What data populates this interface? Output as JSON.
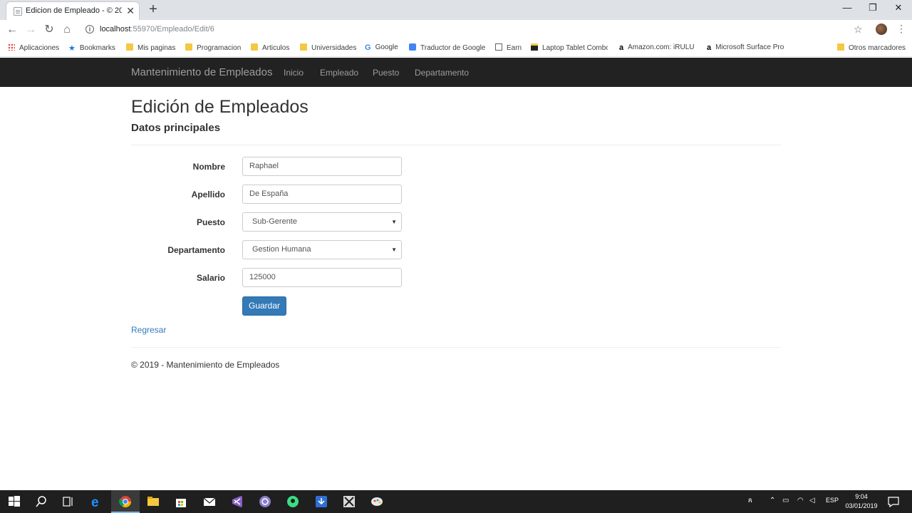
{
  "browser": {
    "tab_title": "Edicion de Empleado - © 2019 -",
    "url_host": "localhost",
    "url_path": ":55970/Empleado/Edit/6",
    "bookmarks": [
      {
        "label": "Aplicaciones",
        "icon": "apps-icon"
      },
      {
        "label": "Bookmarks",
        "icon": "star-icon"
      },
      {
        "label": "Mis paginas",
        "icon": "folder-icon"
      },
      {
        "label": "Programacion",
        "icon": "folder-icon"
      },
      {
        "label": "Articulos",
        "icon": "folder-icon"
      },
      {
        "label": "Universidades",
        "icon": "folder-icon"
      },
      {
        "label": "Google",
        "icon": "google-icon"
      },
      {
        "label": "Traductor de Google",
        "icon": "translate-icon"
      },
      {
        "label": "Earn",
        "icon": "document-icon"
      },
      {
        "label": "Laptop Tablet Combo",
        "icon": "briefcase-icon"
      },
      {
        "label": "Amazon.com: iRULU",
        "icon": "amazon-icon"
      },
      {
        "label": "Microsoft Surface Pro",
        "icon": "amazon-icon"
      },
      {
        "label": "Otros marcadores",
        "icon": "folder-icon"
      }
    ]
  },
  "navbar": {
    "brand": "Mantenimiento de Empleados",
    "links": [
      "Inicio",
      "Empleado",
      "Puesto",
      "Departamento"
    ]
  },
  "page": {
    "title": "Edición de Empleados",
    "subtitle": "Datos principales"
  },
  "form": {
    "nombre": {
      "label": "Nombre",
      "value": "Raphael"
    },
    "apellido": {
      "label": "Apellido",
      "value": "De España"
    },
    "puesto": {
      "label": "Puesto",
      "value": "Sub-Gerente"
    },
    "departamento": {
      "label": "Departamento",
      "value": "Gestion Humana"
    },
    "salario": {
      "label": "Salario",
      "value": "125000"
    },
    "submit_label": "Guardar"
  },
  "back_link": "Regresar",
  "footer": "© 2019 - Mantenimiento de Empleados",
  "taskbar": {
    "language": "ESP",
    "time": "9:04",
    "date": "03/01/2019"
  },
  "colors": {
    "navbar_bg": "#222222",
    "primary": "#337ab7",
    "link": "#337ab7"
  }
}
